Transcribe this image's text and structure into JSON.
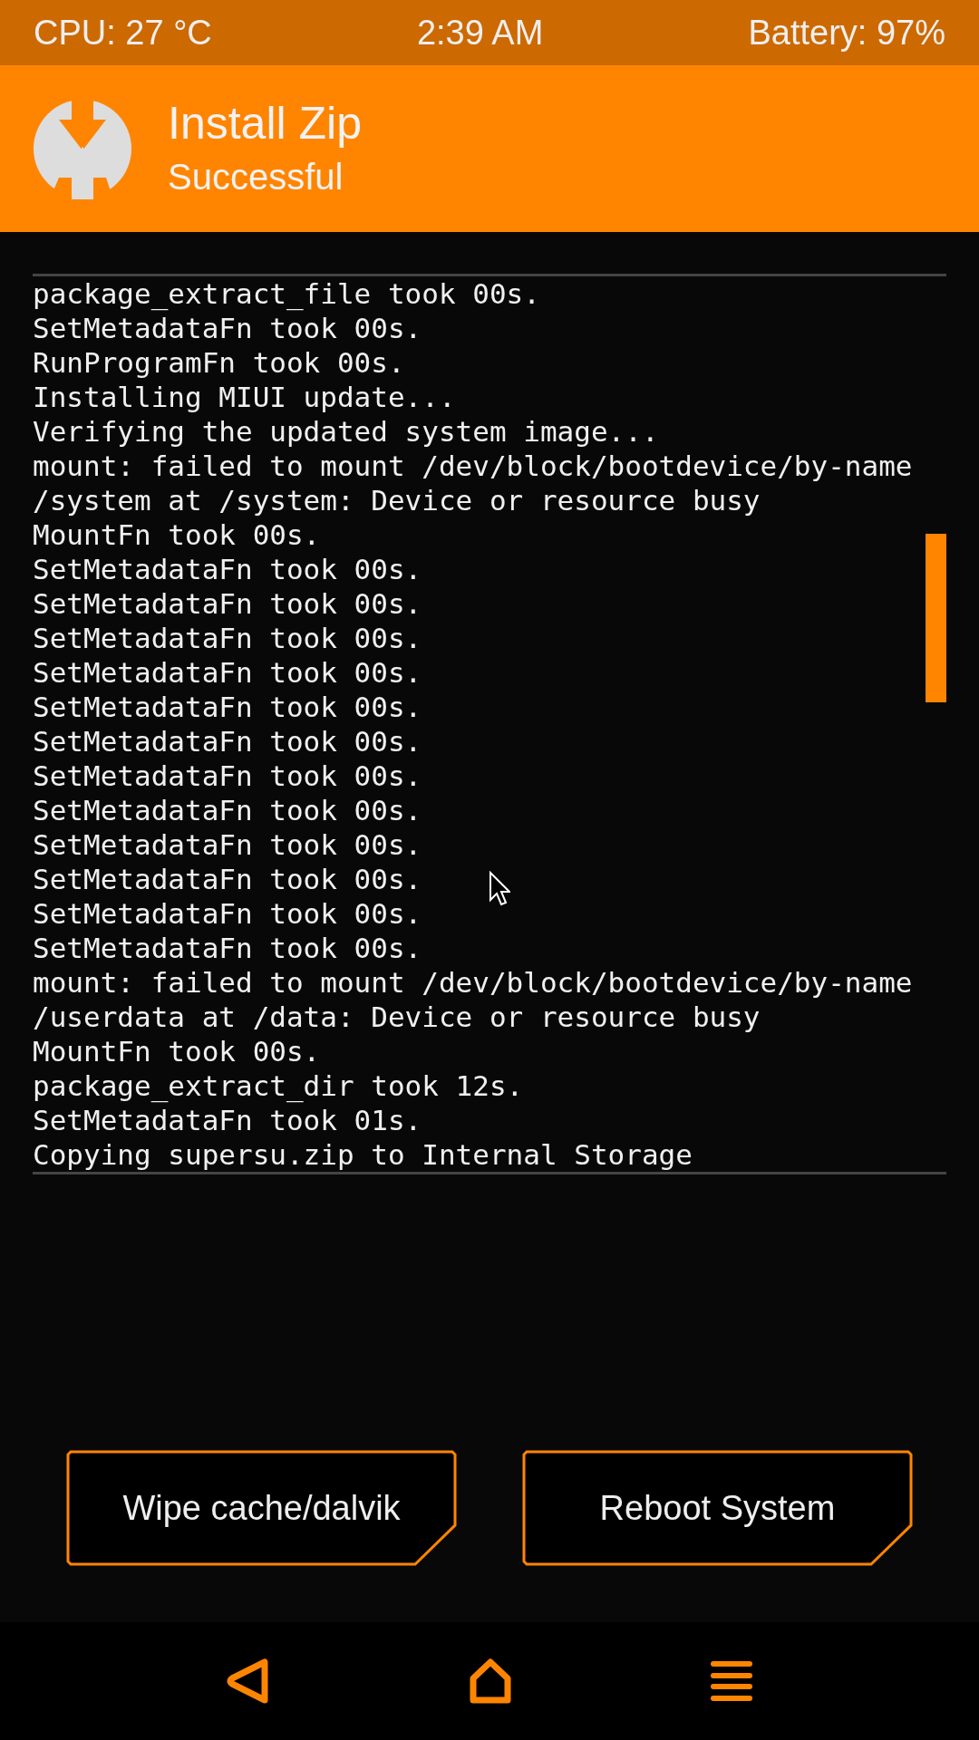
{
  "status_bar": {
    "cpu": "CPU: 27 °C",
    "time": "2:39 AM",
    "battery": "Battery: 97%"
  },
  "header": {
    "title": "Install Zip",
    "subtitle": "Successful"
  },
  "log": [
    "package_extract_file took 00s.",
    "SetMetadataFn took 00s.",
    "RunProgramFn took 00s.",
    "Installing MIUI update...",
    "Verifying the updated system image...",
    "mount: failed to mount /dev/block/bootdevice/by-name",
    "/system at /system: Device or resource busy",
    "MountFn took 00s.",
    "SetMetadataFn took 00s.",
    "SetMetadataFn took 00s.",
    "SetMetadataFn took 00s.",
    "SetMetadataFn took 00s.",
    "SetMetadataFn took 00s.",
    "SetMetadataFn took 00s.",
    "SetMetadataFn took 00s.",
    "SetMetadataFn took 00s.",
    "SetMetadataFn took 00s.",
    "SetMetadataFn took 00s.",
    "SetMetadataFn took 00s.",
    "SetMetadataFn took 00s.",
    "mount: failed to mount /dev/block/bootdevice/by-name",
    "/userdata at /data: Device or resource busy",
    "MountFn took 00s.",
    "package_extract_dir took 12s.",
    "SetMetadataFn took 01s.",
    "Copying supersu.zip to Internal Storage"
  ],
  "buttons": [
    "Wipe cache/dalvik",
    "Reboot System"
  ]
}
